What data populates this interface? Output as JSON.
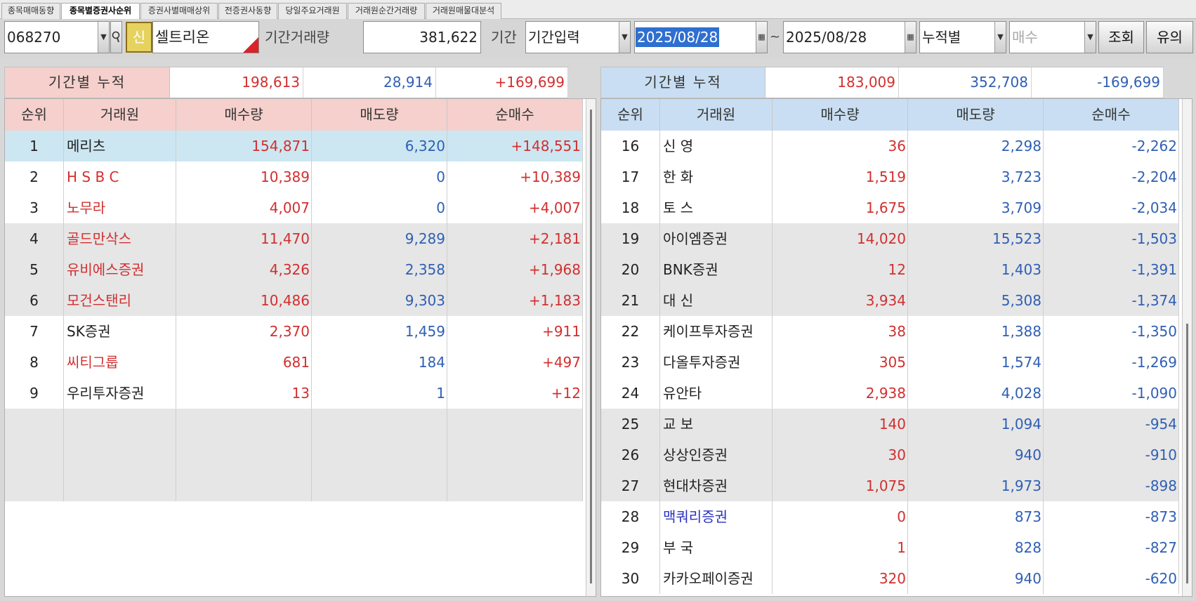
{
  "tabs": [
    {
      "label": "종목매매동향",
      "active": false
    },
    {
      "label": "종목별증권사순위",
      "active": true
    },
    {
      "label": "증권사별매매상위",
      "active": false
    },
    {
      "label": "전증권사동향",
      "active": false
    },
    {
      "label": "당일주요거래원",
      "active": false
    },
    {
      "label": "거래원순간거래량",
      "active": false
    },
    {
      "label": "거래원매물대분석",
      "active": false
    }
  ],
  "toolbar": {
    "stock_code": "068270",
    "badge": "신",
    "stock_name": "셀트리온",
    "period_volume_label": "기간거래량",
    "period_volume": "381,622",
    "period_label": "기간",
    "period_select": "기간입력",
    "date_from": "2025/08/28",
    "tilde": "~",
    "date_to": "2025/08/28",
    "mode_select": "누적별",
    "side_select": "매수",
    "query_button": "조회",
    "notice_button": "유의",
    "dropdown_glyph": "▼",
    "calendar_glyph": "▦"
  },
  "colors": {
    "buy_header_bg": "#f5d0cc",
    "sell_header_bg": "#c9def2",
    "highlight_row": "#cce7f2",
    "band_gray": "#e6e6e6",
    "up_red": "#d22f2f",
    "down_blue": "#2f5fb4",
    "foreign_navy": "#2a33c0"
  },
  "columns": {
    "rank": "순위",
    "broker": "거래원",
    "buy_qty": "매수량",
    "sell_qty": "매도량",
    "net_buy": "순매수"
  },
  "buy_panel": {
    "summary_label": "기간별 누적",
    "summary": [
      "198,613",
      "28,914",
      "+169,699"
    ],
    "rows": [
      {
        "rank": "1",
        "name": "메리츠",
        "buy": "154,871",
        "sell": "6,320",
        "net": "+148,551",
        "foreign": false
      },
      {
        "rank": "2",
        "name": "H S B C",
        "buy": "10,389",
        "sell": "0",
        "net": "+10,389",
        "foreign": true
      },
      {
        "rank": "3",
        "name": "노무라",
        "buy": "4,007",
        "sell": "0",
        "net": "+4,007",
        "foreign": true
      },
      {
        "rank": "4",
        "name": "골드만삭스",
        "buy": "11,470",
        "sell": "9,289",
        "net": "+2,181",
        "foreign": true
      },
      {
        "rank": "5",
        "name": "유비에스증권",
        "buy": "4,326",
        "sell": "2,358",
        "net": "+1,968",
        "foreign": true
      },
      {
        "rank": "6",
        "name": "모건스탠리",
        "buy": "10,486",
        "sell": "9,303",
        "net": "+1,183",
        "foreign": true
      },
      {
        "rank": "7",
        "name": "SK증권",
        "buy": "2,370",
        "sell": "1,459",
        "net": "+911",
        "foreign": false
      },
      {
        "rank": "8",
        "name": "씨티그룹",
        "buy": "681",
        "sell": "184",
        "net": "+497",
        "foreign": true
      },
      {
        "rank": "9",
        "name": "우리투자증권",
        "buy": "13",
        "sell": "1",
        "net": "+12",
        "foreign": false
      }
    ]
  },
  "sell_panel": {
    "summary_label": "기간별 누적",
    "summary": [
      "183,009",
      "352,708",
      "-169,699"
    ],
    "rows": [
      {
        "rank": "16",
        "name": "신  영",
        "buy": "36",
        "sell": "2,298",
        "net": "-2,262"
      },
      {
        "rank": "17",
        "name": "한  화",
        "buy": "1,519",
        "sell": "3,723",
        "net": "-2,204"
      },
      {
        "rank": "18",
        "name": "토  스",
        "buy": "1,675",
        "sell": "3,709",
        "net": "-2,034"
      },
      {
        "rank": "19",
        "name": "아이엠증권",
        "buy": "14,020",
        "sell": "15,523",
        "net": "-1,503"
      },
      {
        "rank": "20",
        "name": "BNK증권",
        "buy": "12",
        "sell": "1,403",
        "net": "-1,391"
      },
      {
        "rank": "21",
        "name": "대  신",
        "buy": "3,934",
        "sell": "5,308",
        "net": "-1,374"
      },
      {
        "rank": "22",
        "name": "케이프투자증권",
        "buy": "38",
        "sell": "1,388",
        "net": "-1,350"
      },
      {
        "rank": "23",
        "name": "다올투자증권",
        "buy": "305",
        "sell": "1,574",
        "net": "-1,269"
      },
      {
        "rank": "24",
        "name": "유안타",
        "buy": "2,938",
        "sell": "4,028",
        "net": "-1,090"
      },
      {
        "rank": "25",
        "name": "교  보",
        "buy": "140",
        "sell": "1,094",
        "net": "-954"
      },
      {
        "rank": "26",
        "name": "상상인증권",
        "buy": "30",
        "sell": "940",
        "net": "-910"
      },
      {
        "rank": "27",
        "name": "현대차증권",
        "buy": "1,075",
        "sell": "1,973",
        "net": "-898"
      },
      {
        "rank": "28",
        "name": "맥쿼리증권",
        "buy": "0",
        "sell": "873",
        "net": "-873",
        "foreign": true
      },
      {
        "rank": "29",
        "name": "부  국",
        "buy": "1",
        "sell": "828",
        "net": "-827"
      },
      {
        "rank": "30",
        "name": "카카오페이증권",
        "buy": "320",
        "sell": "940",
        "net": "-620"
      }
    ]
  }
}
